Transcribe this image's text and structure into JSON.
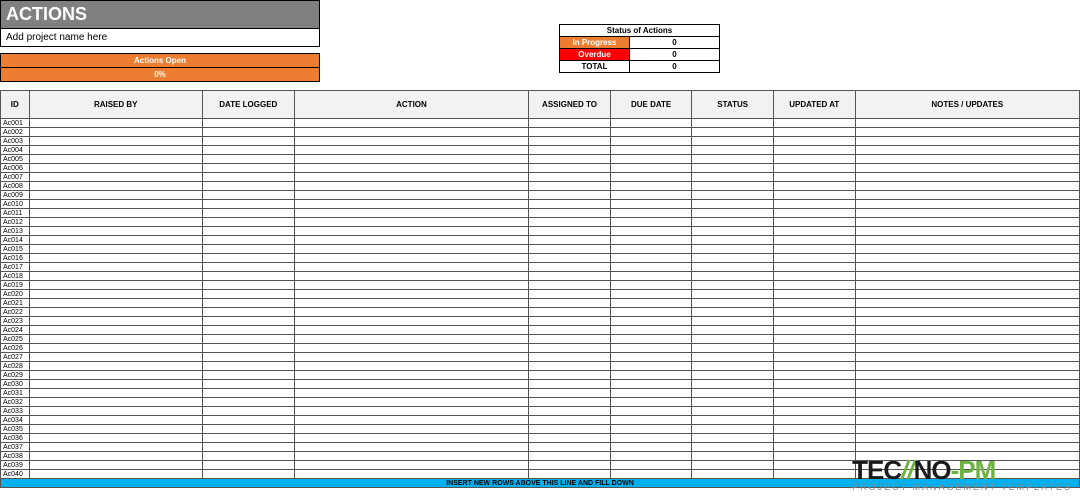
{
  "header": {
    "title": "ACTIONS",
    "project_name": "Add project name here",
    "actions_open_label": "Actions Open",
    "actions_open_percent": "0%"
  },
  "status_summary": {
    "title": "Status of Actions",
    "rows": [
      {
        "label": "In Progress",
        "value": "0"
      },
      {
        "label": "Overdue",
        "value": "0"
      }
    ],
    "total_label": "TOTAL",
    "total_value": "0"
  },
  "columns": {
    "id": "ID",
    "raised_by": "RAISED BY",
    "date_logged": "DATE LOGGED",
    "action": "ACTION",
    "assigned_to": "ASSIGNED TO",
    "due_date": "DUE DATE",
    "status": "STATUS",
    "updated_at": "UPDATED AT",
    "notes": "NOTES / UPDATES"
  },
  "rows": [
    {
      "id": "Ac001"
    },
    {
      "id": "Ac002"
    },
    {
      "id": "Ac003"
    },
    {
      "id": "Ac004"
    },
    {
      "id": "Ac005"
    },
    {
      "id": "Ac006"
    },
    {
      "id": "Ac007"
    },
    {
      "id": "Ac008"
    },
    {
      "id": "Ac009"
    },
    {
      "id": "Ac010"
    },
    {
      "id": "Ac011"
    },
    {
      "id": "Ac012"
    },
    {
      "id": "Ac013"
    },
    {
      "id": "Ac014"
    },
    {
      "id": "Ac015"
    },
    {
      "id": "Ac016"
    },
    {
      "id": "Ac017"
    },
    {
      "id": "Ac018"
    },
    {
      "id": "Ac019"
    },
    {
      "id": "Ac020"
    },
    {
      "id": "Ac021"
    },
    {
      "id": "Ac022"
    },
    {
      "id": "Ac023"
    },
    {
      "id": "Ac024"
    },
    {
      "id": "Ac025"
    },
    {
      "id": "Ac026"
    },
    {
      "id": "Ac027"
    },
    {
      "id": "Ac028"
    },
    {
      "id": "Ac029"
    },
    {
      "id": "Ac030"
    },
    {
      "id": "Ac031"
    },
    {
      "id": "Ac032"
    },
    {
      "id": "Ac033"
    },
    {
      "id": "Ac034"
    },
    {
      "id": "Ac035"
    },
    {
      "id": "Ac036"
    },
    {
      "id": "Ac037"
    },
    {
      "id": "Ac038"
    },
    {
      "id": "Ac039"
    },
    {
      "id": "Ac040"
    }
  ],
  "footer_row": "INSERT NEW ROWS ABOVE THIS LINE AND FILL DOWN",
  "logo": {
    "brand_part1": "TEC",
    "brand_slash": "//",
    "brand_part2": "NO",
    "brand_pm": "-PM",
    "subtitle": "PROJECT MANAGEMENT TEMPLATES"
  }
}
